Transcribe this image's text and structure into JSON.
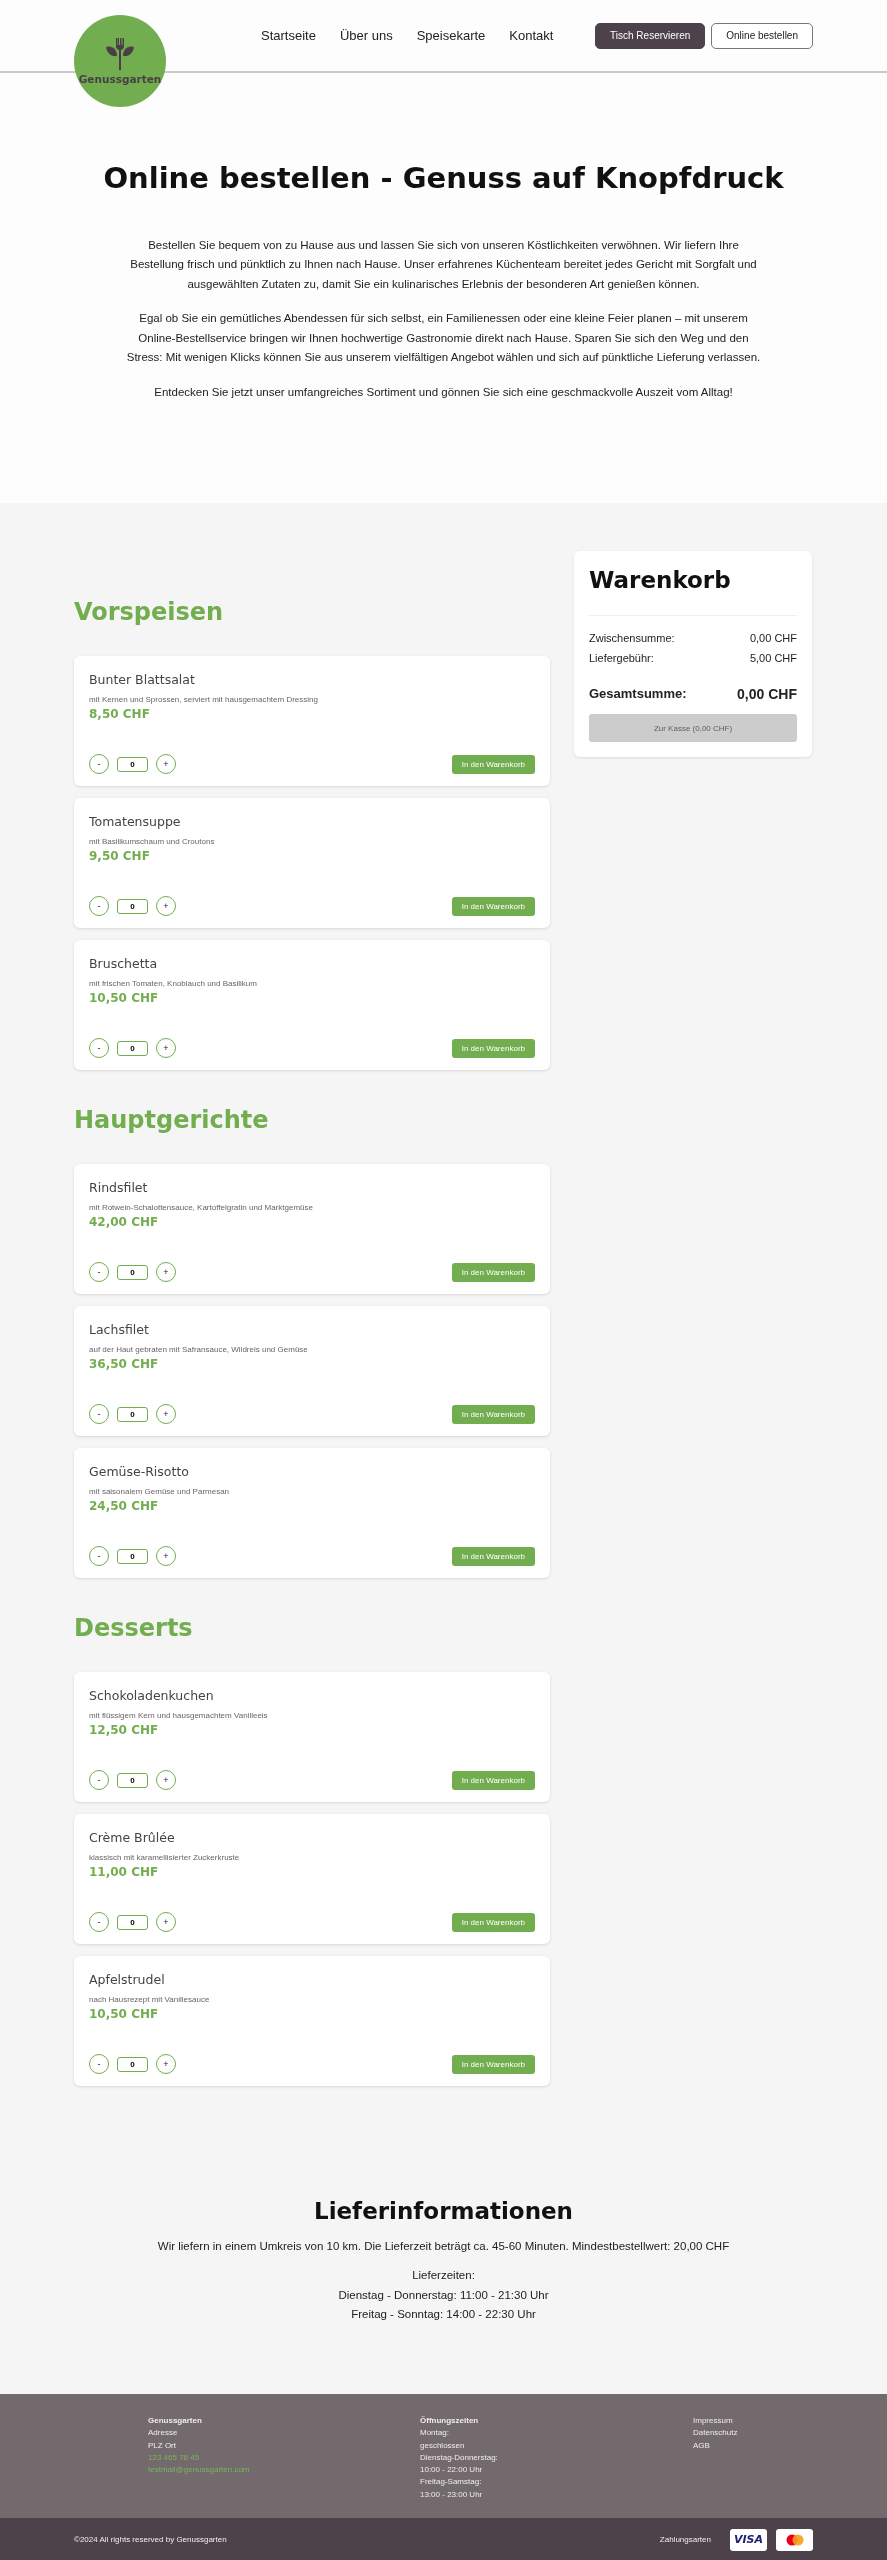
{
  "header": {
    "logo": {
      "text": "Genussgarten"
    },
    "nav": [
      {
        "label": "Startseite"
      },
      {
        "label": "Über uns"
      },
      {
        "label": "Speisekarte"
      },
      {
        "label": "Kontakt"
      }
    ],
    "buttons": [
      {
        "label": "Tisch Reservieren",
        "kind": "primary"
      },
      {
        "label": "Online bestellen",
        "kind": "outline"
      }
    ]
  },
  "hero": {
    "title": "Online bestellen - Genuss auf Knopfdruck",
    "paragraphs": [
      "Bestellen Sie bequem von zu Hause aus und lassen Sie sich von unseren Köstlichkeiten verwöhnen. Wir liefern Ihre Bestellung frisch und pünktlich zu Ihnen nach Hause. Unser erfahrenes Küchenteam bereitet jedes Gericht mit Sorgfalt und ausgewählten Zutaten zu, damit Sie ein kulinarisches Erlebnis der besonderen Art genießen können.",
      "Egal ob Sie ein gemütliches Abendessen für sich selbst, ein Familienessen oder eine kleine Feier planen – mit unserem Online-Bestellservice bringen wir Ihnen hochwertige Gastronomie direkt nach Hause. Sparen Sie sich den Weg und den Stress: Mit wenigen Klicks können Sie aus unserem vielfältigen Angebot wählen und sich auf pünktliche Lieferung verlassen.",
      "Entdecken Sie jetzt unser umfangreiches Sortiment und gönnen Sie sich eine geschmackvolle Auszeit vom Alltag!"
    ]
  },
  "menu": [
    {
      "title": "Vorspeisen",
      "items": [
        {
          "name": "Bunter Blattsalat",
          "description": "mit Kernen und Sprossen, serviert mit hausgemachtem Dressing",
          "price": "8,50 CHF",
          "minus": "-",
          "quantity": "0",
          "plus": "+",
          "add_button": "In den Warenkorb"
        },
        {
          "name": "Tomatensuppe",
          "description": "mit Basilikumschaum und Croutons",
          "price": "9,50 CHF",
          "minus": "-",
          "quantity": "0",
          "plus": "+",
          "add_button": "In den Warenkorb"
        },
        {
          "name": "Bruschetta",
          "description": "mit frischen Tomaten, Knoblauch und Basilikum",
          "price": "10,50 CHF",
          "minus": "-",
          "quantity": "0",
          "plus": "+",
          "add_button": "In den Warenkorb"
        }
      ]
    },
    {
      "title": "Hauptgerichte",
      "items": [
        {
          "name": "Rindsfilet",
          "description": "mit Rotwein-Schalottensauce, Kartoffelgratin und Marktgemüse",
          "price": "42,00 CHF",
          "minus": "-",
          "quantity": "0",
          "plus": "+",
          "add_button": "In den Warenkorb"
        },
        {
          "name": "Lachsfilet",
          "description": "auf der Haut gebraten mit Safransauce, Wildreis und Gemüse",
          "price": "36,50 CHF",
          "minus": "-",
          "quantity": "0",
          "plus": "+",
          "add_button": "In den Warenkorb"
        },
        {
          "name": "Gemüse-Risotto",
          "description": "mit saisonalem Gemüse und Parmesan",
          "price": "24,50 CHF",
          "minus": "-",
          "quantity": "0",
          "plus": "+",
          "add_button": "In den Warenkorb"
        }
      ]
    },
    {
      "title": "Desserts",
      "items": [
        {
          "name": "Schokoladenkuchen",
          "description": "mit flüssigem Kern und hausgemachtem Vanilleeis",
          "price": "12,50 CHF",
          "minus": "-",
          "quantity": "0",
          "plus": "+",
          "add_button": "In den Warenkorb"
        },
        {
          "name": "Crème Brûlée",
          "description": "klassisch mit karamellisierter Zuckerkruste",
          "price": "11,00 CHF",
          "minus": "-",
          "quantity": "0",
          "plus": "+",
          "add_button": "In den Warenkorb"
        },
        {
          "name": "Apfelstrudel",
          "description": "nach Hausrezept mit Vanillesauce",
          "price": "10,50 CHF",
          "minus": "-",
          "quantity": "0",
          "plus": "+",
          "add_button": "In den Warenkorb"
        }
      ]
    }
  ],
  "cart": {
    "title": "Warenkorb",
    "rows": [
      {
        "label": "Zwischensumme:",
        "value": "0,00 CHF"
      },
      {
        "label": "Liefergebühr:",
        "value": "5,00 CHF"
      }
    ],
    "total": {
      "label": "Gesamtsumme:",
      "value": "0,00 CHF"
    },
    "checkout": {
      "label": "Zur Kasse (0,00 CHF)",
      "disabled": true
    }
  },
  "delivery": {
    "title": "Lieferinformationen",
    "text": "Wir liefern in einem Umkreis von 10 km. Die Lieferzeit beträgt ca. 45-60 Minuten. Mindestbestellwert: 20,00 CHF",
    "lines": [
      "Lieferzeiten:",
      "Dienstag - Donnerstag: 11:00 - 21:30 Uhr",
      "Freitag - Sonntag: 14:00 - 22:30 Uhr"
    ]
  },
  "footer": {
    "columns": [
      {
        "lines": [
          {
            "text": "Genussgarten",
            "kind": "heading"
          },
          {
            "text": "Adresse",
            "kind": "plain"
          },
          {
            "text": "PLZ Ort",
            "kind": "plain"
          },
          {
            "text": "123 465 78 45",
            "kind": "link"
          },
          {
            "text": "testmail@genussgarten.com",
            "kind": "link"
          }
        ]
      },
      {
        "lines": [
          {
            "text": "Öffnungszeiten",
            "kind": "heading"
          },
          {
            "text": "Montag:",
            "kind": "plain"
          },
          {
            "text": "geschlossen",
            "kind": "plain"
          },
          {
            "text": "Dienstag-Donnerstag:",
            "kind": "plain"
          },
          {
            "text": "10:00 - 22:00 Uhr",
            "kind": "plain"
          },
          {
            "text": "Freitag-Samstag:",
            "kind": "plain"
          },
          {
            "text": "13:00 - 23:00 Uhr",
            "kind": "plain"
          }
        ]
      },
      {
        "lines": [
          {
            "text": "Impressum",
            "kind": "nav"
          },
          {
            "text": "Datenschutz",
            "kind": "nav"
          },
          {
            "text": "AGB",
            "kind": "nav"
          }
        ]
      }
    ],
    "copyright": "©2024 All rights reserved by Genussgarten",
    "payment_label": "Zahlungsarten",
    "payment_cards": [
      {
        "kind": "visa",
        "text": "VISA"
      },
      {
        "kind": "mastercard"
      }
    ]
  }
}
